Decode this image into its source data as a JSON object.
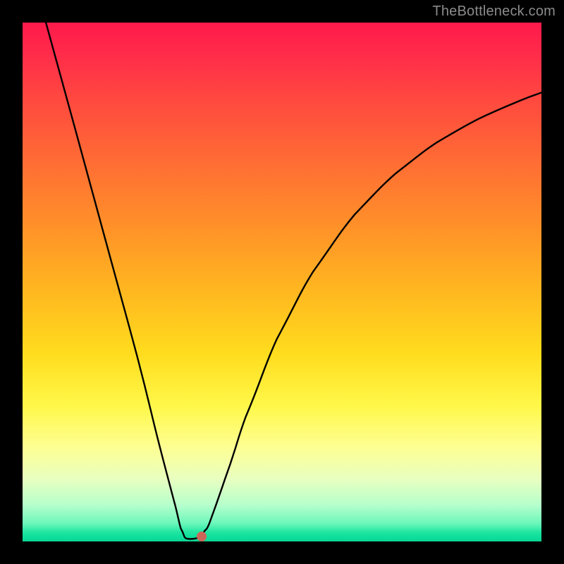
{
  "watermark": "TheBottleneck.com",
  "dot_color": "#cc6659",
  "curve_color": "#000000",
  "chart_data": {
    "type": "line",
    "title": "",
    "xlabel": "",
    "ylabel": "",
    "xlim": [
      0,
      1
    ],
    "ylim": [
      0,
      1
    ],
    "series": [
      {
        "name": "curve",
        "points": [
          {
            "x": 0.045,
            "y": 1.0
          },
          {
            "x": 0.1,
            "y": 0.8
          },
          {
            "x": 0.16,
            "y": 0.58
          },
          {
            "x": 0.22,
            "y": 0.36
          },
          {
            "x": 0.26,
            "y": 0.2
          },
          {
            "x": 0.29,
            "y": 0.085
          },
          {
            "x": 0.305,
            "y": 0.025
          },
          {
            "x": 0.315,
            "y": 0.006
          },
          {
            "x": 0.335,
            "y": 0.006
          },
          {
            "x": 0.345,
            "y": 0.01
          },
          {
            "x": 0.36,
            "y": 0.035
          },
          {
            "x": 0.39,
            "y": 0.12
          },
          {
            "x": 0.43,
            "y": 0.24
          },
          {
            "x": 0.49,
            "y": 0.39
          },
          {
            "x": 0.56,
            "y": 0.52
          },
          {
            "x": 0.64,
            "y": 0.63
          },
          {
            "x": 0.72,
            "y": 0.71
          },
          {
            "x": 0.8,
            "y": 0.77
          },
          {
            "x": 0.88,
            "y": 0.815
          },
          {
            "x": 0.96,
            "y": 0.85
          },
          {
            "x": 1.0,
            "y": 0.865
          }
        ]
      }
    ],
    "marker": {
      "x": 0.345,
      "y": 0.01
    }
  }
}
